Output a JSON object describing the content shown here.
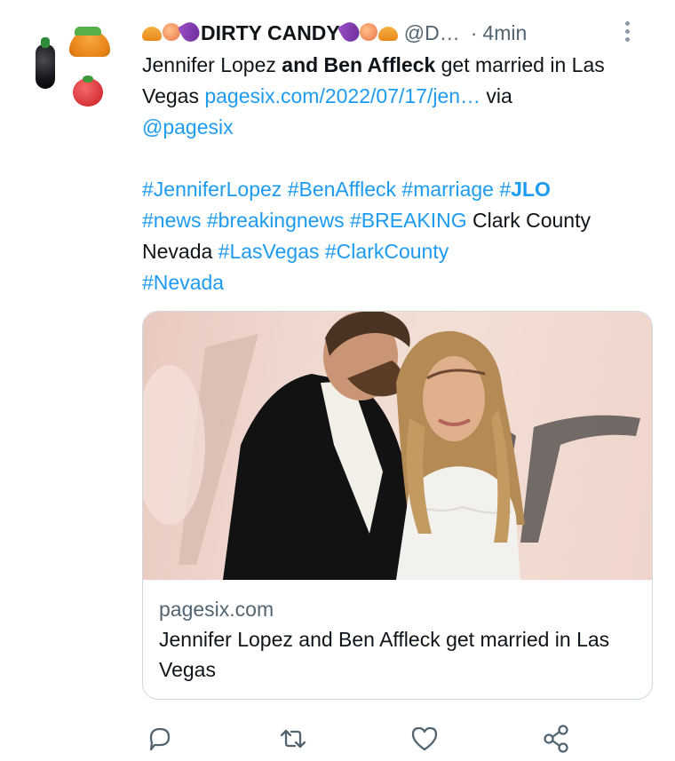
{
  "header": {
    "display_name": "DIRTY CANDY",
    "handle": "@D…",
    "separator": "·",
    "time": "4min",
    "name_emojis_left": [
      "taco",
      "peach",
      "eggplant"
    ],
    "name_emojis_right": [
      "eggplant",
      "peach",
      "taco"
    ]
  },
  "tweet": {
    "line1_a": "Jennifer Lopez ",
    "line1_b": "and Ben Affleck",
    "line1_c": " get married in Las Vegas ",
    "link": "pagesix.com/2022/07/17/jen…",
    "via": " via",
    "mention": "@pagesix",
    "tags1": [
      "#JenniferLopez",
      "#BenAffleck",
      "#marriage"
    ],
    "tag_jlo_prefix": "#",
    "tag_jlo": "JLO",
    "tags2": [
      "#news",
      "#breakingnews",
      "#BREAKING"
    ],
    "plain": "Clark County Nevada",
    "tags3": [
      "#LasVegas",
      "#ClarkCounty"
    ],
    "tags4": [
      "#Nevada"
    ]
  },
  "card": {
    "domain": "pagesix.com",
    "title": "Jennifer Lopez and Ben Affleck get married in Las Vegas",
    "image_alt": "Jennifer Lopez and Ben Affleck"
  },
  "actions": {
    "icons": [
      "reply-icon",
      "retweet-icon",
      "like-icon",
      "share-icon"
    ]
  },
  "colors": {
    "link": "#1d9bf0",
    "secondary": "#536471",
    "text": "#0f1419",
    "border": "#cfd9de"
  }
}
